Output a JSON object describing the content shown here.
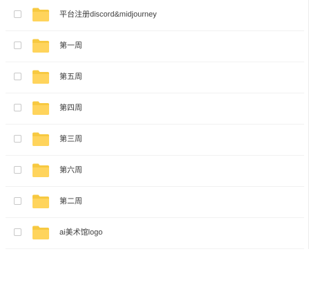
{
  "icons": {
    "checkbox": "checkbox-icon",
    "folder": "folder-icon"
  },
  "colors": {
    "folder_fill": "#ffd45c",
    "folder_tab": "#f7c941",
    "checkbox_border": "#c8c8c8",
    "row_divider": "#f1f1f1",
    "text": "#3c3c3c"
  },
  "files": [
    {
      "name": "平台注册discord&midjourney"
    },
    {
      "name": "第一周"
    },
    {
      "name": "第五周"
    },
    {
      "name": "第四周"
    },
    {
      "name": "第三周"
    },
    {
      "name": "第六周"
    },
    {
      "name": "第二周"
    },
    {
      "name": "ai美术馆logo"
    }
  ]
}
